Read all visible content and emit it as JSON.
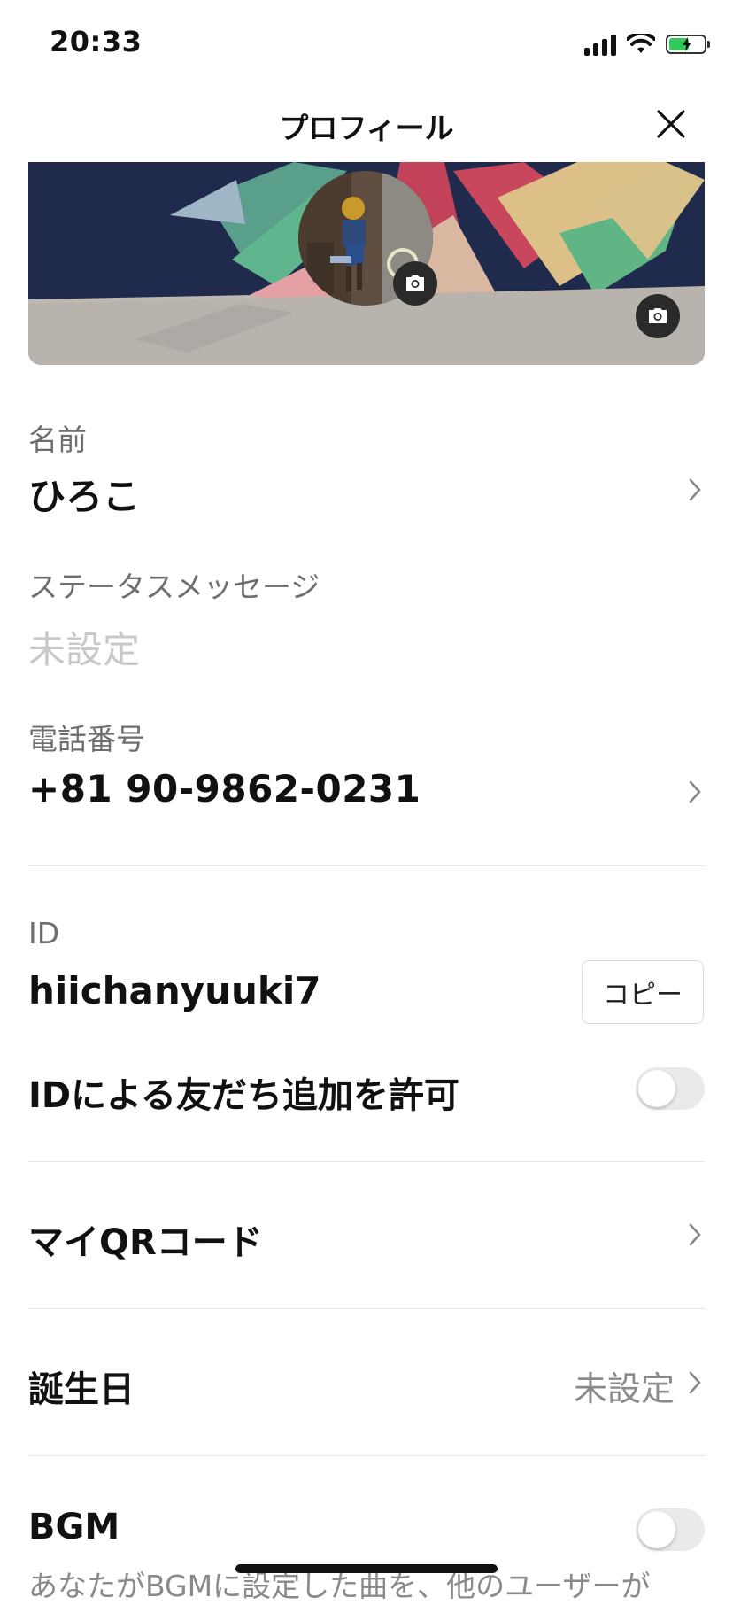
{
  "status_bar": {
    "time": "20:33",
    "battery_color": "#34c759"
  },
  "header": {
    "title": "プロフィール",
    "close_icon": "close-icon"
  },
  "profile": {
    "cover_icon": "camera-icon",
    "avatar_icon": "camera-icon"
  },
  "fields": {
    "name": {
      "label": "名前",
      "value": "ひろこ"
    },
    "status": {
      "label": "ステータスメッセージ",
      "value": "未設定"
    },
    "phone": {
      "label": "電話番号",
      "value": "+81 90-9862-0231"
    },
    "id": {
      "label": "ID",
      "value": "hiichanyuuki7",
      "copy_label": "コピー"
    }
  },
  "settings": {
    "allow_id_add": {
      "label": "IDによる友だち追加を許可",
      "enabled": false
    },
    "my_qr": {
      "label": "マイQRコード"
    },
    "birthday": {
      "label": "誕生日",
      "value": "未設定"
    },
    "bgm": {
      "label": "BGM",
      "enabled": false,
      "description": "あなたがBGMに設定した曲を、他のユーザーが"
    }
  }
}
